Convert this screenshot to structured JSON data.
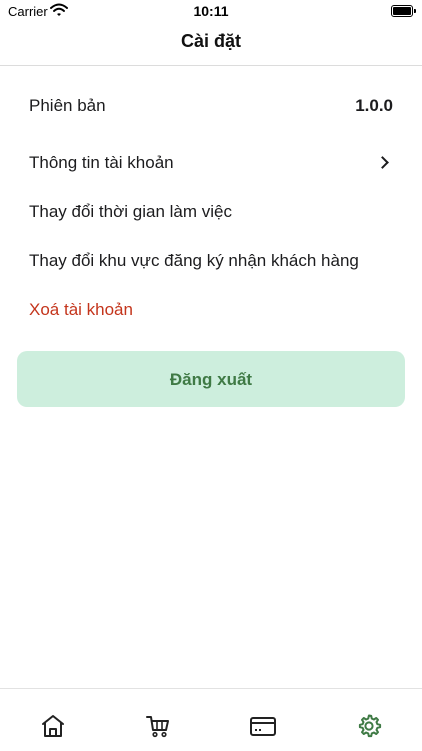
{
  "status_bar": {
    "carrier": "Carrier",
    "time": "10:11"
  },
  "header": {
    "title": "Cài đặt"
  },
  "settings": {
    "version_label": "Phiên bản",
    "version_value": "1.0.0",
    "account_info": "Thông tin tài khoản",
    "change_work_time": "Thay đổi thời gian làm việc",
    "change_region": "Thay đổi khu vực đăng ký nhận khách hàng",
    "delete_account": "Xoá tài khoản",
    "logout": "Đăng xuất"
  },
  "tabbar": {
    "items": [
      {
        "icon": "home-icon",
        "active": false
      },
      {
        "icon": "cart-icon",
        "active": false
      },
      {
        "icon": "card-icon",
        "active": false
      },
      {
        "icon": "gear-icon",
        "active": true
      }
    ]
  },
  "colors": {
    "accent": "#3f7a45",
    "logout_bg": "#cdeedd",
    "danger": "#c4351c"
  }
}
